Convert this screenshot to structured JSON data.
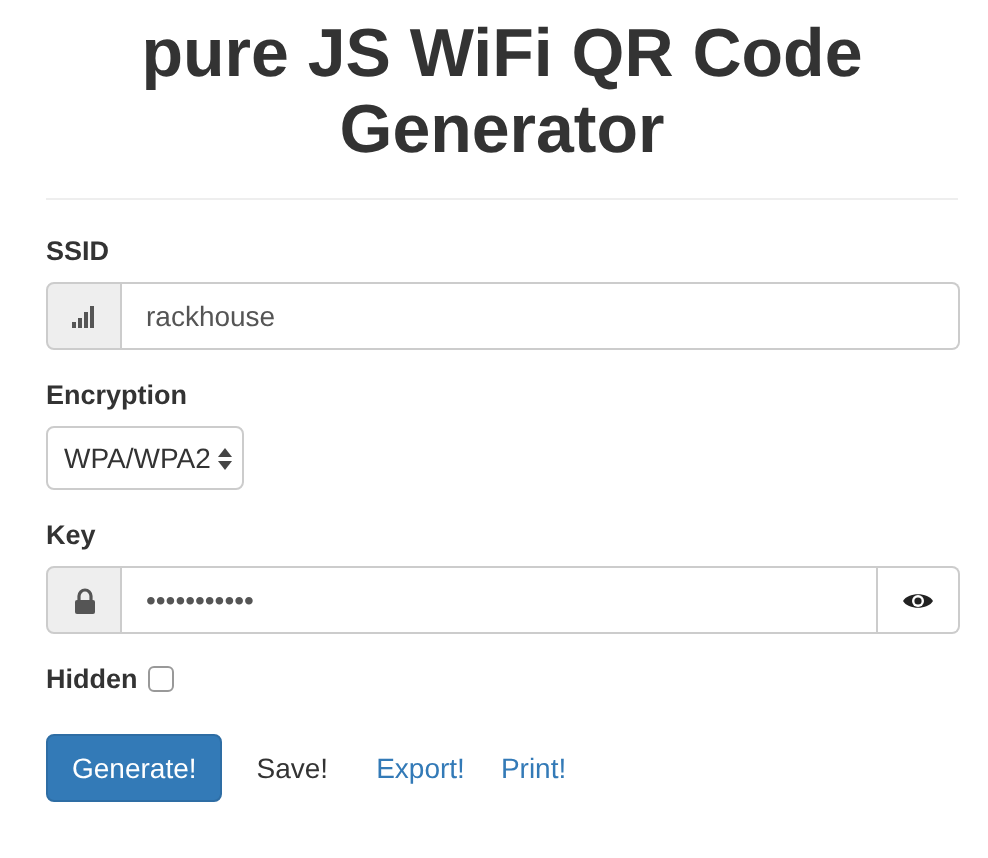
{
  "title": "pure JS WiFi QR Code Generator",
  "ssid": {
    "label": "SSID",
    "value": "rackhouse"
  },
  "encryption": {
    "label": "Encryption",
    "value": "WPA/WPA2"
  },
  "key": {
    "label": "Key",
    "value": "•••••••••••"
  },
  "hidden": {
    "label": "Hidden",
    "checked": false
  },
  "actions": [
    {
      "label": "Generate!",
      "kind": "primary"
    },
    {
      "label": "Save!",
      "kind": "plain"
    },
    {
      "label": "Export!",
      "kind": "link"
    },
    {
      "label": "Print!",
      "kind": "link"
    }
  ]
}
